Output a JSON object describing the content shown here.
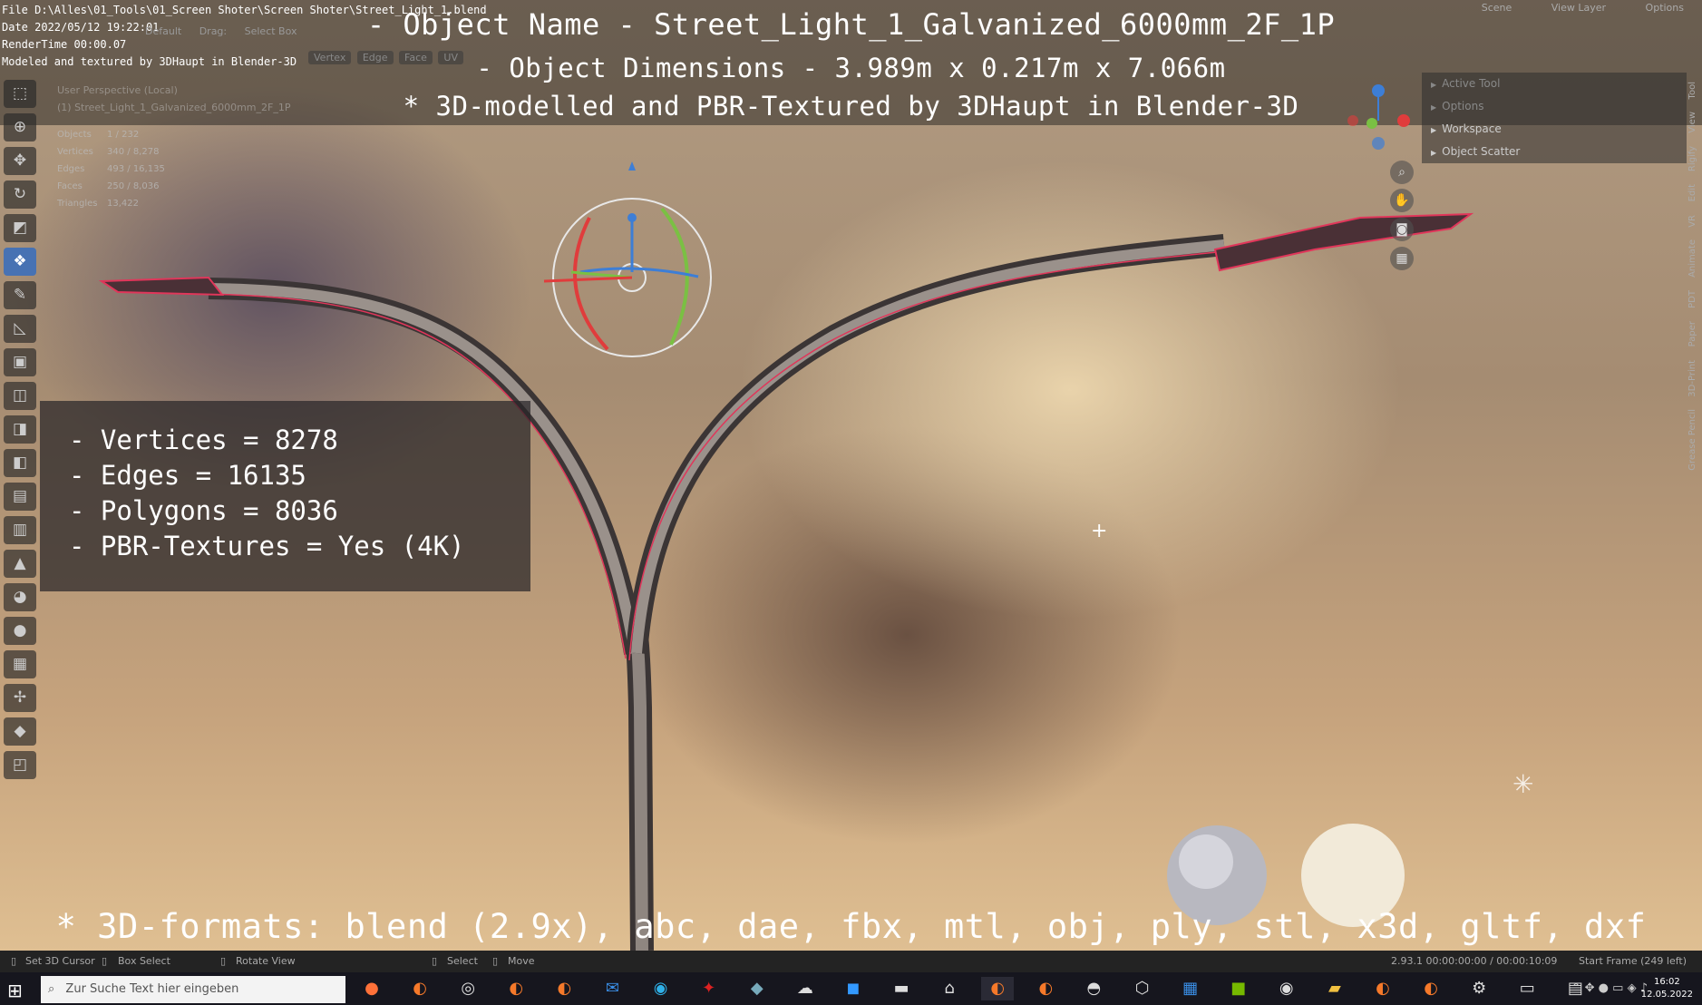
{
  "file_info": {
    "file_line": "File D:\\Alles\\01_Tools\\01_Screen Shoter\\Screen Shoter\\Street_Light_1.blend",
    "date_line": "Date 2022/05/12 19:22:01",
    "render_line": "RenderTime 00:00.07",
    "modeled_line": "Modeled and textured by 3DHaupt in Blender-3D"
  },
  "overlay_titles": {
    "object_name": "- Object Name - Street_Light_1_Galvanized_6000mm_2F_1P",
    "dimensions": "- Object Dimensions -  3.989m x 0.217m x 7.066m",
    "credit": "* 3D-modelled and PBR-Textured by 3DHaupt in Blender-3D"
  },
  "header": {
    "orientation": "Default",
    "drag_label": "Drag:",
    "drag_value": "Select Box",
    "modes": [
      "Vertex",
      "Edge",
      "Face",
      "UV"
    ],
    "scene": "Scene",
    "view_layer": "View Layer",
    "options": "Options"
  },
  "viewport_header": {
    "view_name": "User Perspective (Local)",
    "object_name": "(1) Street_Light_1_Galvanized_6000mm_2F_1P"
  },
  "stats": [
    {
      "key": "Objects",
      "value": "1 / 232"
    },
    {
      "key": "Vertices",
      "value": "340 / 8,278"
    },
    {
      "key": "Edges",
      "value": "493 / 16,135"
    },
    {
      "key": "Faces",
      "value": "250 / 8,036"
    },
    {
      "key": "Triangles",
      "value": "13,422"
    }
  ],
  "mesh_info": {
    "vertices": "- Vertices = 8278",
    "edges": "- Edges = 16135",
    "polygons": "- Polygons = 8036",
    "pbr": "- PBR-Textures =  Yes (4K)"
  },
  "right_panel": {
    "items": [
      "Active Tool",
      "Options",
      "Workspace",
      "Object Scatter"
    ]
  },
  "side_tabs": [
    "Tool",
    "View",
    "Rigify",
    "Edit",
    "VR",
    "Animate",
    "PDT",
    "Paper",
    "3D-Print",
    "Grease Pencil"
  ],
  "tools": [
    "select-box",
    "cursor",
    "move",
    "rotate",
    "scale",
    "transform",
    "annotate",
    "measure",
    "add-cube",
    "extrude",
    "inset",
    "bevel",
    "loop-cut",
    "knife",
    "poly-build",
    "spin",
    "smooth",
    "edge-slide",
    "shrink",
    "shear",
    "rip"
  ],
  "formats_line": "* 3D-formats: blend (2.9x), abc, dae, fbx, mtl, obj, ply, stl, x3d, gltf, dxf",
  "statusbar": {
    "set_cursor": "Set 3D Cursor",
    "box_select": "Box Select",
    "rotate_view": "Rotate View",
    "select": "Select",
    "move": "Move",
    "version": "2.93.1  00:00:00:00 / 00:00:10:09",
    "start_frame": "Start Frame (249 left)"
  },
  "taskbar": {
    "search_placeholder": "Zur Suche Text hier eingeben",
    "time": "16:02",
    "date": "12.05.2022"
  },
  "colors": {
    "accent": "#4772b3",
    "highlight_edges": "#e0365a",
    "gizmo_x": "#e03c3c",
    "gizmo_y": "#7ac043",
    "gizmo_z": "#3d7ed6"
  }
}
